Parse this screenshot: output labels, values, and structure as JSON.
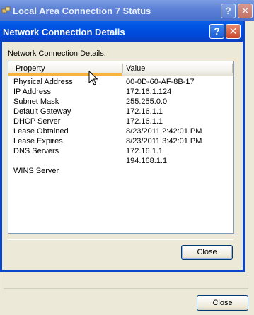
{
  "back_window": {
    "title": "Local Area Connection 7 Status",
    "help_glyph": "?",
    "close_glyph": "✕",
    "close_button_label": "Close"
  },
  "dialog": {
    "title": "Network Connection Details",
    "help_glyph": "?",
    "close_glyph": "✕",
    "details_label": "Network Connection Details:",
    "columns": [
      "Property",
      "Value"
    ],
    "rows": [
      [
        "Physical Address",
        "00-0D-60-AF-8B-17"
      ],
      [
        "IP Address",
        "172.16.1.124"
      ],
      [
        "Subnet Mask",
        "255.255.0.0"
      ],
      [
        "Default Gateway",
        "172.16.1.1"
      ],
      [
        "DHCP Server",
        "172.16.1.1"
      ],
      [
        "Lease Obtained",
        "8/23/2011 2:42:01 PM"
      ],
      [
        "Lease Expires",
        "8/23/2011 3:42:01 PM"
      ],
      [
        "DNS Servers",
        "172.16.1.1"
      ],
      [
        "",
        "194.168.1.1"
      ],
      [
        "WINS Server",
        ""
      ]
    ],
    "close_button_label": "Close"
  },
  "colors": {
    "dialog_titlebar": "#0054e3",
    "inactive_titlebar": "#7c9de3",
    "window_face": "#ece9d8",
    "sort_highlight": "#f9b23c"
  },
  "icons": {
    "back_title": "network-connection-icon",
    "cursor": "mouse-pointer-icon"
  }
}
